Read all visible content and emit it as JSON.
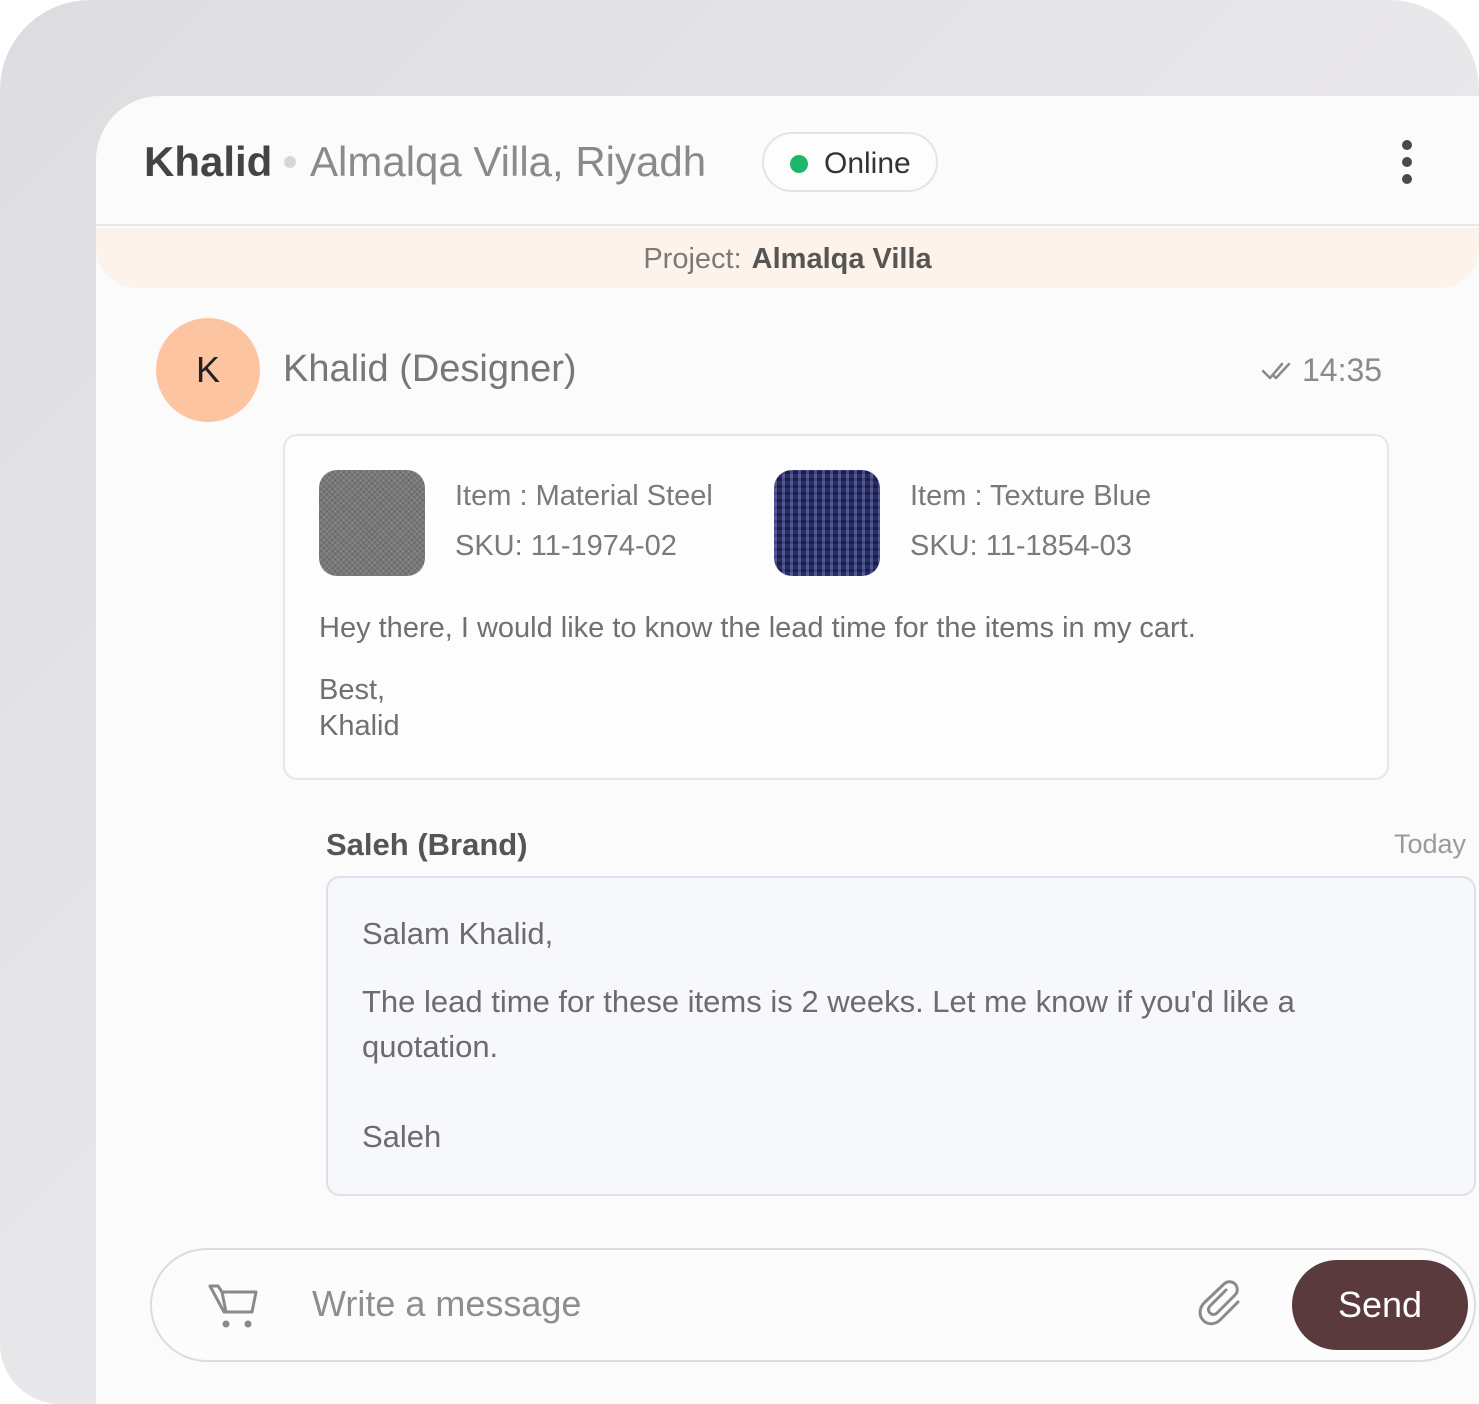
{
  "header": {
    "contact_name": "Khalid",
    "location": "Almalqa Villa, Riyadh",
    "status": "Online",
    "status_color": "#1db66b"
  },
  "project": {
    "label": "Project:",
    "name": "Almalqa Villa"
  },
  "messages": [
    {
      "avatar_initial": "K",
      "sender": "Khalid (Designer)",
      "time": "14:35",
      "read_icon": "double-check-icon",
      "items": [
        {
          "item_label": "Item : Material Steel",
          "sku": "SKU: 11-1974-02",
          "swatch": "steel-grey-fabric"
        },
        {
          "item_label": "Item : Texture Blue",
          "sku": "SKU: 11-1854-03",
          "swatch": "navy-knit-texture"
        }
      ],
      "body": "Hey there, I would like to know the lead time for the items in my cart.",
      "signoff_1": "Best,",
      "signoff_2": "Khalid"
    },
    {
      "sender": "Saleh (Brand)",
      "time": "Today",
      "greeting": "Salam Khalid,",
      "body_line_1": "The lead time for these items is 2 weeks. Let me know if you'd like a",
      "body_line_2": "quotation.",
      "signoff": "Saleh"
    }
  ],
  "composer": {
    "placeholder": "Write a message",
    "send_label": "Send",
    "cart_icon": "cart-icon",
    "attach_icon": "paperclip-icon"
  },
  "colors": {
    "send_button": "#5a3a3d",
    "avatar": "#fdc4a2",
    "project_banner": "#fdf3ea"
  }
}
